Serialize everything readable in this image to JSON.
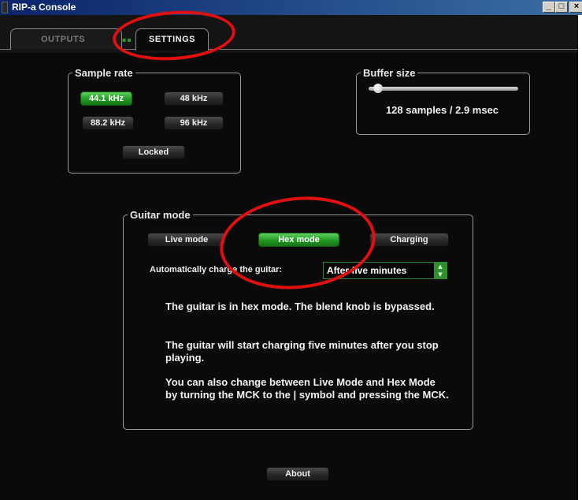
{
  "window": {
    "title": "RIP-a Console",
    "controls": {
      "minimize": "_",
      "maximize": "□",
      "close": "×"
    }
  },
  "tabs": [
    {
      "label": "OUTPUTS",
      "active": false,
      "indicator": "▪▪"
    },
    {
      "label": "SETTINGS",
      "active": true
    }
  ],
  "sample_rate": {
    "legend": "Sample rate",
    "options": [
      "44.1 kHz",
      "48 kHz",
      "88.2 kHz",
      "96 kHz"
    ],
    "selected": "44.1 kHz",
    "locked_label": "Locked"
  },
  "buffer": {
    "legend": "Buffer size",
    "value_text": "128 samples / 2.9 msec",
    "slider_level": 0.04
  },
  "guitar_mode": {
    "legend": "Guitar mode",
    "modes": [
      "Live mode",
      "Hex mode",
      "Charging"
    ],
    "selected": "Hex mode",
    "auto_charge_label": "Automatically charge the guitar:",
    "auto_charge_value": "After five minutes",
    "paragraphs": [
      "The guitar is in hex mode.  The blend knob is bypassed.",
      "The guitar will start charging five minutes after you stop playing.",
      "You can also change between Live Mode and Hex Mode by turning the MCK to the | symbol and pressing the MCK."
    ]
  },
  "about_label": "About",
  "colors": {
    "accent_green": "#229a22",
    "annotation_red": "#e01010",
    "background": "#0a0a0a"
  }
}
